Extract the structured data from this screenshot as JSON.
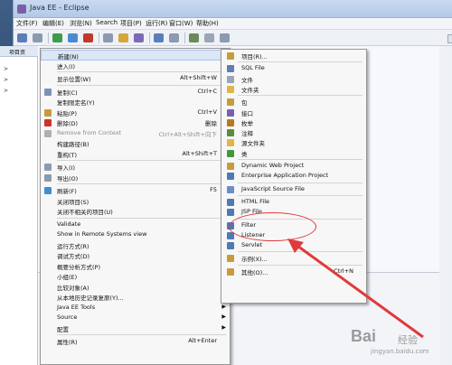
{
  "window": {
    "title": "Java EE - Eclipse"
  },
  "menubar": [
    "文件(F)",
    "编辑(E)",
    "浏览(N)",
    "Search",
    "项目(P)",
    "运行(R)",
    "窗口(W)",
    "帮助(H)"
  ],
  "panel": {
    "tab_label": "项目资",
    "tree_items": [
      "> ",
      "> ",
      "> "
    ]
  },
  "context_menu": {
    "items": [
      {
        "label": "新建(N)",
        "shortcut": "",
        "submenu": true,
        "icon": "none",
        "highlighted": true
      },
      {
        "label": "进入(I)",
        "shortcut": "",
        "submenu": false,
        "icon": "none"
      },
      {
        "sep": true
      },
      {
        "label": "显示位置(W)",
        "shortcut": "Alt+Shift+W",
        "submenu": true,
        "icon": "none"
      },
      {
        "sep": true
      },
      {
        "label": "复制(C)",
        "shortcut": "Ctrl+C",
        "submenu": false,
        "icon": "copy-icon"
      },
      {
        "label": "复制限定名(Y)",
        "shortcut": "",
        "submenu": false,
        "icon": "none"
      },
      {
        "label": "粘贴(P)",
        "shortcut": "Ctrl+V",
        "submenu": false,
        "icon": "paste-icon"
      },
      {
        "label": "删除(D)",
        "shortcut": "删除",
        "submenu": false,
        "icon": "delete-icon"
      },
      {
        "label": "Remove from Context",
        "shortcut": "Ctrl+Alt+Shift+向下",
        "submenu": false,
        "icon": "remove-context-icon",
        "disabled": true
      },
      {
        "label": "构建路径(B)",
        "shortcut": "",
        "submenu": true,
        "icon": "none"
      },
      {
        "label": "重构(T)",
        "shortcut": "Alt+Shift+T",
        "submenu": true,
        "icon": "none"
      },
      {
        "sep": true
      },
      {
        "label": "导入(I)",
        "shortcut": "",
        "submenu": true,
        "icon": "import-icon"
      },
      {
        "label": "导出(O)",
        "shortcut": "",
        "submenu": true,
        "icon": "export-icon"
      },
      {
        "sep": true
      },
      {
        "label": "刷新(F)",
        "shortcut": "F5",
        "submenu": false,
        "icon": "refresh-icon"
      },
      {
        "label": "关闭项目(S)",
        "shortcut": "",
        "submenu": false,
        "icon": "none"
      },
      {
        "label": "关闭不相关的项目(U)",
        "shortcut": "",
        "submenu": false,
        "icon": "none"
      },
      {
        "sep": true
      },
      {
        "label": "Validate",
        "shortcut": "",
        "submenu": false,
        "icon": "none"
      },
      {
        "label": "Show in Remote Systems view",
        "shortcut": "",
        "submenu": false,
        "icon": "none"
      },
      {
        "label": "运行方式(R)",
        "shortcut": "",
        "submenu": true,
        "icon": "none"
      },
      {
        "label": "调试方式(D)",
        "shortcut": "",
        "submenu": true,
        "icon": "none"
      },
      {
        "label": "概要分析方式(P)",
        "shortcut": "",
        "submenu": true,
        "icon": "none"
      },
      {
        "label": "小组(E)",
        "shortcut": "",
        "submenu": true,
        "icon": "none"
      },
      {
        "label": "比较对象(A)",
        "shortcut": "",
        "submenu": true,
        "icon": "none"
      },
      {
        "label": "从本地历史记录复原(Y)...",
        "shortcut": "",
        "submenu": false,
        "icon": "none"
      },
      {
        "label": "Java EE Tools",
        "shortcut": "",
        "submenu": true,
        "icon": "none"
      },
      {
        "label": "Source",
        "shortcut": "",
        "submenu": true,
        "icon": "none"
      },
      {
        "label": "配置",
        "shortcut": "",
        "submenu": true,
        "icon": "none"
      },
      {
        "sep": true
      },
      {
        "label": "属性(R)",
        "shortcut": "Alt+Enter",
        "submenu": false,
        "icon": "none"
      }
    ]
  },
  "submenu": {
    "items": [
      {
        "label": "项目(R)...",
        "icon": "project-icon",
        "color": "#c89b3c"
      },
      {
        "sep": true
      },
      {
        "label": "SQL File",
        "icon": "sql-file-icon",
        "color": "#5b7fb6"
      },
      {
        "label": "文件",
        "icon": "file-icon",
        "color": "#9aa6b5"
      },
      {
        "label": "文件夹",
        "icon": "folder-icon",
        "color": "#e2b646"
      },
      {
        "sep": true
      },
      {
        "label": "包",
        "icon": "package-icon",
        "color": "#c89b3c"
      },
      {
        "label": "接口",
        "icon": "interface-icon",
        "color": "#7b5fb3"
      },
      {
        "label": "枚举",
        "icon": "enum-icon",
        "color": "#b7791f"
      },
      {
        "label": "注释",
        "icon": "annotation-icon",
        "color": "#5e8c3a"
      },
      {
        "label": "源文件夹",
        "icon": "source-folder-icon",
        "color": "#e2b646"
      },
      {
        "label": "类",
        "icon": "class-icon",
        "color": "#3f9a3f"
      },
      {
        "sep": true
      },
      {
        "label": "Dynamic Web Project",
        "icon": "web-project-icon",
        "color": "#c89b3c"
      },
      {
        "label": "Enterprise Application Project",
        "icon": "ear-project-icon",
        "color": "#4f79b5"
      },
      {
        "sep": true
      },
      {
        "label": "JavaScript Source File",
        "icon": "js-file-icon",
        "color": "#6b8fc4"
      },
      {
        "sep": true
      },
      {
        "label": "HTML File",
        "icon": "html-file-icon",
        "color": "#4f79b5"
      },
      {
        "label": "JSP File",
        "icon": "jsp-file-icon",
        "color": "#4f79b5"
      },
      {
        "sep": true
      },
      {
        "label": "Filter",
        "icon": "filter-icon",
        "color": "#4f79b5"
      },
      {
        "label": "Listener",
        "icon": "listener-icon",
        "color": "#4f79b5"
      },
      {
        "label": "Servlet",
        "icon": "servlet-icon",
        "color": "#4f79b5"
      },
      {
        "sep": true
      },
      {
        "label": "示例(X)...",
        "icon": "example-icon",
        "color": "#c89b3c"
      },
      {
        "sep": true
      },
      {
        "label": "其他(O)...",
        "shortcut": "Ctrl+N",
        "icon": "other-icon",
        "color": "#c89b3c"
      }
    ]
  },
  "watermark": {
    "logo_text": "Bai",
    "logo_text_cn": "经验",
    "url": "jingyan.baidu.com"
  },
  "colors": {
    "annotation_red": "#e03a3a",
    "highlight": "#dbe6f6"
  }
}
